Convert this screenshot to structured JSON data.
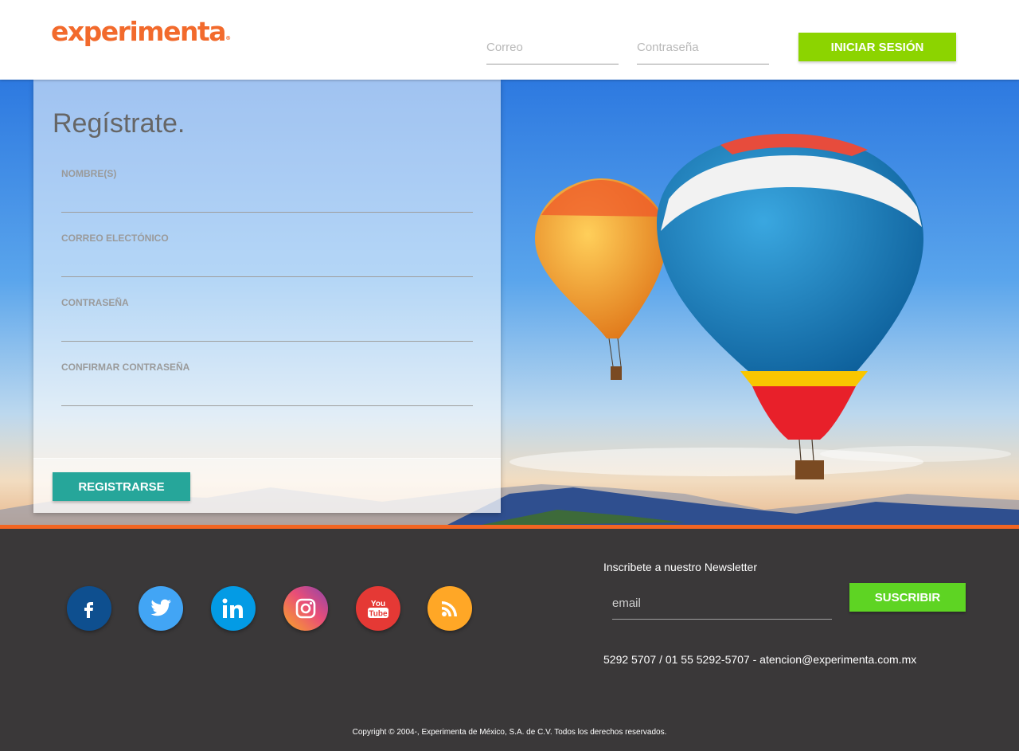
{
  "header": {
    "logo_text": "experimenta",
    "logo_reg": "®",
    "email_placeholder": "Correo",
    "password_placeholder": "Contraseña",
    "login_label": "INICIAR SESIÓN"
  },
  "register": {
    "title": "Regístrate.",
    "fields": [
      {
        "label": "NOMBRE(S)"
      },
      {
        "label": "CORREO ELECTÓNICO"
      },
      {
        "label": "CONTRASEÑA"
      },
      {
        "label": "CONFIRMAR CONTRASEÑA"
      }
    ],
    "submit_label": "REGISTRARSE"
  },
  "footer": {
    "social": [
      {
        "name": "facebook",
        "icon": "facebook-icon",
        "color": "#0e4f8f"
      },
      {
        "name": "twitter",
        "icon": "twitter-icon",
        "color": "#42a5f5"
      },
      {
        "name": "linkedin",
        "icon": "linkedin-icon",
        "color": "#039be5"
      },
      {
        "name": "instagram",
        "icon": "instagram-icon",
        "color": "#e94e77"
      },
      {
        "name": "youtube",
        "icon": "youtube-icon",
        "color": "#e53935"
      },
      {
        "name": "rss",
        "icon": "rss-icon",
        "color": "#ffa726"
      }
    ],
    "youtube_you": "You",
    "youtube_tube": "Tube",
    "newsletter_title": "Inscribete a nuestro Newsletter",
    "newsletter_placeholder": "email",
    "subscribe_label": "SUSCRIBIR",
    "contact": "5292 5707 / 01 55 5292-5707 - atencion@experimenta.com.mx",
    "copyright": "Copyright © 2004-, Experimenta de México, S.A. de C.V. Todos los derechos reservados."
  },
  "colors": {
    "brand_orange": "#f26a2c",
    "login_green": "#8cd400",
    "register_teal": "#26a69a",
    "subscribe_green": "#5ed423",
    "footer_bg": "#3a3839"
  }
}
